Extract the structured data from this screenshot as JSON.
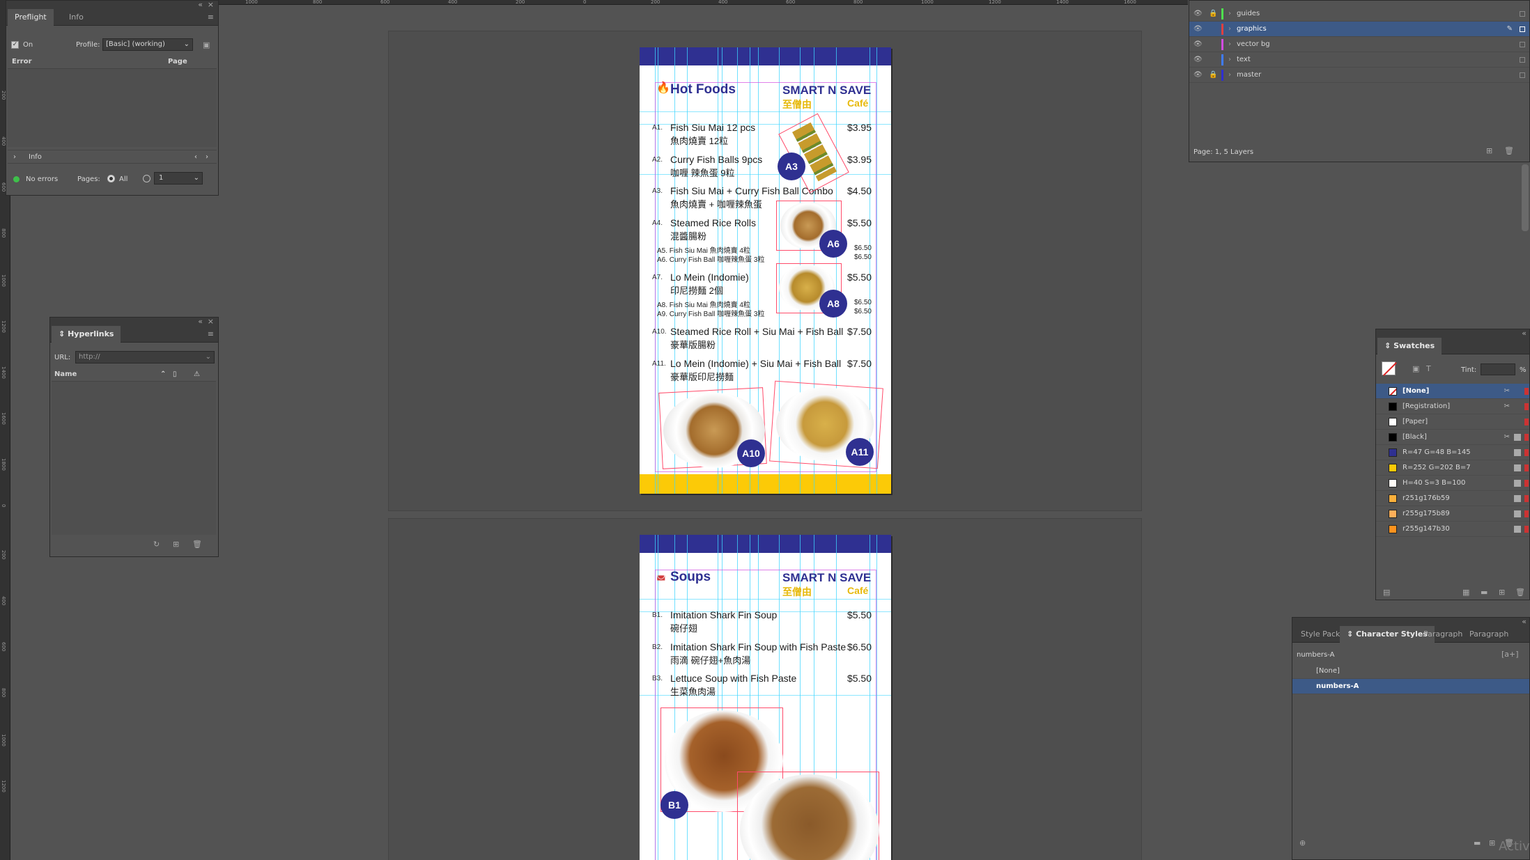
{
  "rulers": {
    "top": [
      "1600",
      "1400",
      "1200",
      "1000",
      "800",
      "600",
      "400",
      "200",
      "0",
      "200",
      "400",
      "600",
      "800",
      "1000",
      "1200",
      "1400",
      "1600"
    ],
    "left": [
      "200",
      "400",
      "600",
      "800",
      "1000",
      "1200",
      "1400",
      "1600",
      "1800",
      "0",
      "200",
      "400",
      "600",
      "800",
      "1000",
      "1200"
    ]
  },
  "preflight": {
    "tabs": [
      "Preflight",
      "Info"
    ],
    "on_label": "On",
    "profile_label": "Profile:",
    "profile_value": "[Basic] (working)",
    "col_error": "Error",
    "col_page": "Page",
    "info_label": "Info",
    "status": "No errors",
    "pages_label": "Pages:",
    "all_label": "All",
    "range_value": "1"
  },
  "hyperlinks": {
    "title": "Hyperlinks",
    "url_label": "URL:",
    "url_placeholder": "http://",
    "name_col": "Name"
  },
  "layers": {
    "items": [
      {
        "name": "guides",
        "color": "#4fe04f",
        "locked": true
      },
      {
        "name": "graphics",
        "color": "#e04040",
        "locked": false,
        "selected": true
      },
      {
        "name": "vector bg",
        "color": "#d24ce0",
        "locked": false
      },
      {
        "name": "text",
        "color": "#3f7bff",
        "locked": false
      },
      {
        "name": "master",
        "color": "#2f2fd0",
        "locked": true
      }
    ],
    "footer": "Page: 1, 5 Layers"
  },
  "swatches": {
    "title": "Swatches",
    "tint_label": "Tint:",
    "tint_unit": "%",
    "items": [
      {
        "name": "[None]",
        "color": "none",
        "selected": true
      },
      {
        "name": "[Registration]",
        "color": "#000000"
      },
      {
        "name": "[Paper]",
        "color": "#ffffff"
      },
      {
        "name": "[Black]",
        "color": "#000000"
      },
      {
        "name": "R=47 G=48 B=145",
        "color": "#2f3091"
      },
      {
        "name": "R=252 G=202 B=7",
        "color": "#fcca07"
      },
      {
        "name": "H=40 S=3 B=100",
        "color": "#fffcf7"
      },
      {
        "name": "r251g176b59",
        "color": "#fbb03b"
      },
      {
        "name": "r255g175b89",
        "color": "#ffaf59"
      },
      {
        "name": "r255g147b30",
        "color": "#ff931e"
      }
    ]
  },
  "styles": {
    "tabs": [
      "Style Pack:",
      "Character Styles",
      "Paragraph",
      "Paragraph"
    ],
    "current": "numbers-A",
    "items": [
      "[None]",
      "numbers-A"
    ]
  },
  "watermark": "Activ",
  "brand": {
    "line1": "SMART N SAVE",
    "line2_zh": "至僧由",
    "line2": "Café"
  },
  "page1": {
    "title": "Hot Foods",
    "items": [
      {
        "code": "A1.",
        "name": "Fish Siu Mai 12 pcs",
        "zh": "魚肉燒賣 12粒",
        "price": "$3.95"
      },
      {
        "code": "A2.",
        "name": "Curry Fish Balls 9pcs",
        "zh": "咖喱 辣魚蛋 9粒",
        "price": "$3.95"
      },
      {
        "code": "A3.",
        "name": "Fish Siu Mai + Curry Fish Ball Combo",
        "zh": "魚肉燒賣 + 咖喱辣魚蛋",
        "price": "$4.50"
      },
      {
        "code": "A4.",
        "name": "Steamed Rice Rolls",
        "zh": "混醬腸粉",
        "price": "$5.50"
      },
      {
        "code": "A7.",
        "name": "Lo Mein (Indomie)",
        "zh": "印尼撈麵 2個",
        "price": "$5.50"
      },
      {
        "code": "A10.",
        "name": "Steamed Rice Roll + Siu Mai + Fish Ball",
        "zh": "豪華版腸粉",
        "price": "$7.50"
      },
      {
        "code": "A11.",
        "name": "Lo Mein (Indomie) + Siu Mai + Fish Ball",
        "zh": "豪華版印尼撈麵",
        "price": "$7.50"
      }
    ],
    "subs": [
      {
        "name": "A5. Fish Siu Mai 魚肉燒賣 4粒",
        "price": "$6.50"
      },
      {
        "name": "A6. Curry Fish Ball 咖喱辣魚蛋 3粒",
        "price": "$6.50"
      },
      {
        "name": "A8. Fish Siu Mai 魚肉燒賣 4粒",
        "price": "$6.50"
      },
      {
        "name": "A9. Curry Fish Ball 咖喱辣魚蛋 3粒",
        "price": "$6.50"
      }
    ],
    "badges": [
      "A3",
      "A6",
      "A8",
      "A10",
      "A11"
    ]
  },
  "page2": {
    "title": "Soups",
    "items": [
      {
        "code": "B1.",
        "name": "Imitation Shark Fin Soup",
        "zh": "碗仔翅",
        "price": "$5.50"
      },
      {
        "code": "B2.",
        "name": "Imitation Shark Fin Soup with Fish Paste",
        "zh": "雨滴 碗仔翅+魚肉湯",
        "price": "$6.50"
      },
      {
        "code": "B3.",
        "name": "Lettuce Soup with Fish Paste",
        "zh": "生菜魚肉湯",
        "price": "$5.50"
      }
    ],
    "badges": [
      "B1"
    ]
  }
}
